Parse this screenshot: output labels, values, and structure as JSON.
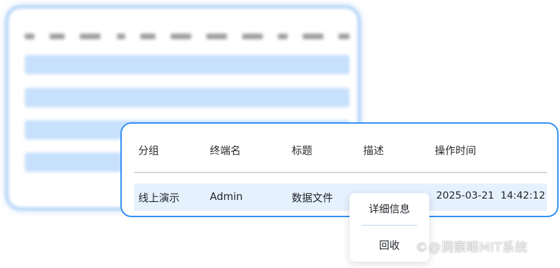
{
  "table": {
    "headers": [
      "分组",
      "终端名",
      "标题",
      "描述",
      "操作时间"
    ],
    "row": {
      "group": "线上演示",
      "terminal": "Admin",
      "title": "数据文件",
      "description": "",
      "time": "2025-03-21  14:42:12"
    }
  },
  "context_menu": {
    "items": [
      "详细信息",
      "回收"
    ]
  },
  "watermark": "©@洞察眼MIT系统",
  "colors": {
    "accent": "#2f8ef5",
    "row_highlight": "#e6f1fe",
    "blurred_border": "#a9cdf5"
  }
}
